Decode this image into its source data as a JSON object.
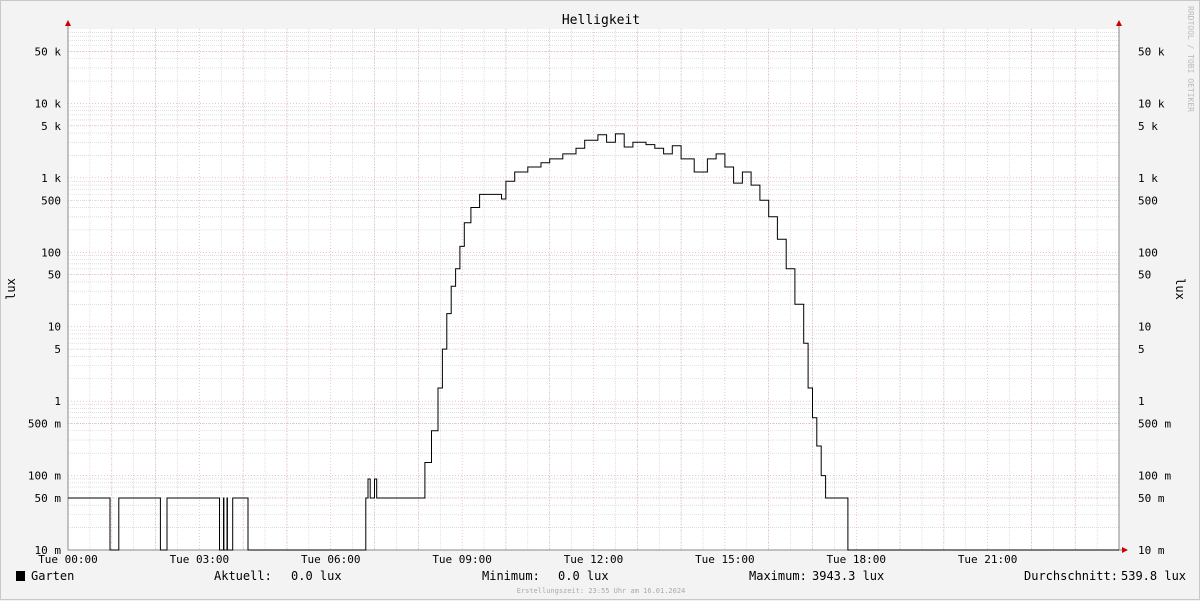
{
  "chart_data": {
    "type": "line",
    "title": "Helligkeit",
    "ylabel": "lux",
    "ylabel_right": "lux",
    "watermark": "RRDTOOL / TOBI OETIKER",
    "y_scale": "log",
    "ylim": [
      0.01,
      100000
    ],
    "xlim": [
      0,
      24
    ],
    "grid": true,
    "y_ticks": [
      {
        "value": 0.01,
        "label": "10 m"
      },
      {
        "value": 0.05,
        "label": "50 m"
      },
      {
        "value": 0.1,
        "label": "100 m"
      },
      {
        "value": 0.5,
        "label": "500 m"
      },
      {
        "value": 1,
        "label": "1"
      },
      {
        "value": 5,
        "label": "5"
      },
      {
        "value": 10,
        "label": "10"
      },
      {
        "value": 50,
        "label": "50"
      },
      {
        "value": 100,
        "label": "100"
      },
      {
        "value": 500,
        "label": "500"
      },
      {
        "value": 1000,
        "label": "1 k"
      },
      {
        "value": 5000,
        "label": "5 k"
      },
      {
        "value": 10000,
        "label": "10 k"
      },
      {
        "value": 50000,
        "label": "50 k"
      }
    ],
    "x_ticks": [
      {
        "value": 0,
        "label": "Tue 00:00"
      },
      {
        "value": 3,
        "label": "Tue 03:00"
      },
      {
        "value": 6,
        "label": "Tue 06:00"
      },
      {
        "value": 9,
        "label": "Tue 09:00"
      },
      {
        "value": 12,
        "label": "Tue 12:00"
      },
      {
        "value": 15,
        "label": "Tue 15:00"
      },
      {
        "value": 18,
        "label": "Tue 18:00"
      },
      {
        "value": 21,
        "label": "Tue 21:00"
      }
    ],
    "series": [
      {
        "name": "Garten",
        "color": "#000000",
        "x": [
          0,
          0.95,
          0.96,
          1.15,
          1.16,
          2.1,
          2.11,
          2.25,
          2.26,
          3.45,
          3.46,
          3.55,
          3.56,
          3.63,
          3.64,
          3.75,
          3.76,
          4.1,
          4.11,
          6.8,
          6.85,
          6.9,
          7.0,
          7.05,
          7.2,
          7.3,
          7.4,
          8.1,
          8.15,
          8.3,
          8.45,
          8.55,
          8.65,
          8.75,
          8.85,
          8.95,
          9.05,
          9.2,
          9.4,
          9.6,
          9.9,
          10.0,
          10.2,
          10.5,
          10.8,
          11.0,
          11.3,
          11.6,
          11.8,
          12.1,
          12.3,
          12.5,
          12.7,
          12.9,
          13.2,
          13.4,
          13.6,
          13.8,
          14.0,
          14.3,
          14.6,
          14.8,
          15.0,
          15.2,
          15.4,
          15.6,
          15.8,
          16.0,
          16.2,
          16.4,
          16.6,
          16.8,
          16.9,
          17.0,
          17.1,
          17.2,
          17.3,
          17.4,
          17.5,
          17.6,
          17.7,
          17.8,
          17.81,
          24
        ],
        "y": [
          0.05,
          0.05,
          0.01,
          0.01,
          0.05,
          0.05,
          0.01,
          0.01,
          0.05,
          0.05,
          0.01,
          0.05,
          0.01,
          0.05,
          0.01,
          0.01,
          0.05,
          0.05,
          0.01,
          0.05,
          0.09,
          0.05,
          0.09,
          0.05,
          0.05,
          0.05,
          0.05,
          0.05,
          0.15,
          0.4,
          1.5,
          5,
          15,
          35,
          60,
          120,
          250,
          400,
          600,
          600,
          520,
          900,
          1200,
          1400,
          1600,
          1800,
          2100,
          2500,
          3200,
          3800,
          3000,
          3900,
          2600,
          3000,
          2800,
          2500,
          2100,
          2700,
          1800,
          1200,
          1800,
          2100,
          1400,
          850,
          1200,
          800,
          500,
          300,
          150,
          60,
          20,
          6,
          1.5,
          0.6,
          0.25,
          0.1,
          0.05,
          0.05,
          0.05,
          0.05,
          0.05,
          0.05,
          0.01,
          0.01
        ]
      }
    ]
  },
  "legend": {
    "series_name": "Garten",
    "swatch_color": "#000000",
    "current_label": "Aktuell:",
    "current_value": "0.0 lux",
    "min_label": "Minimum:",
    "min_value": "0.0 lux",
    "max_label": "Maximum:",
    "max_value": "3943.3 lux",
    "avg_label": "Durchschnitt:",
    "avg_value": "539.8 lux"
  },
  "footer": "Erstellungszeit: 23:55 Uhr am 16.01.2024",
  "colors": {
    "background": "#f3f3f3",
    "plot": "#ffffff",
    "major_grid": "#e8a0a0",
    "minor_grid": "#cccccc",
    "axis": "#888888",
    "arrow": "#cc0000",
    "line": "#000000"
  }
}
